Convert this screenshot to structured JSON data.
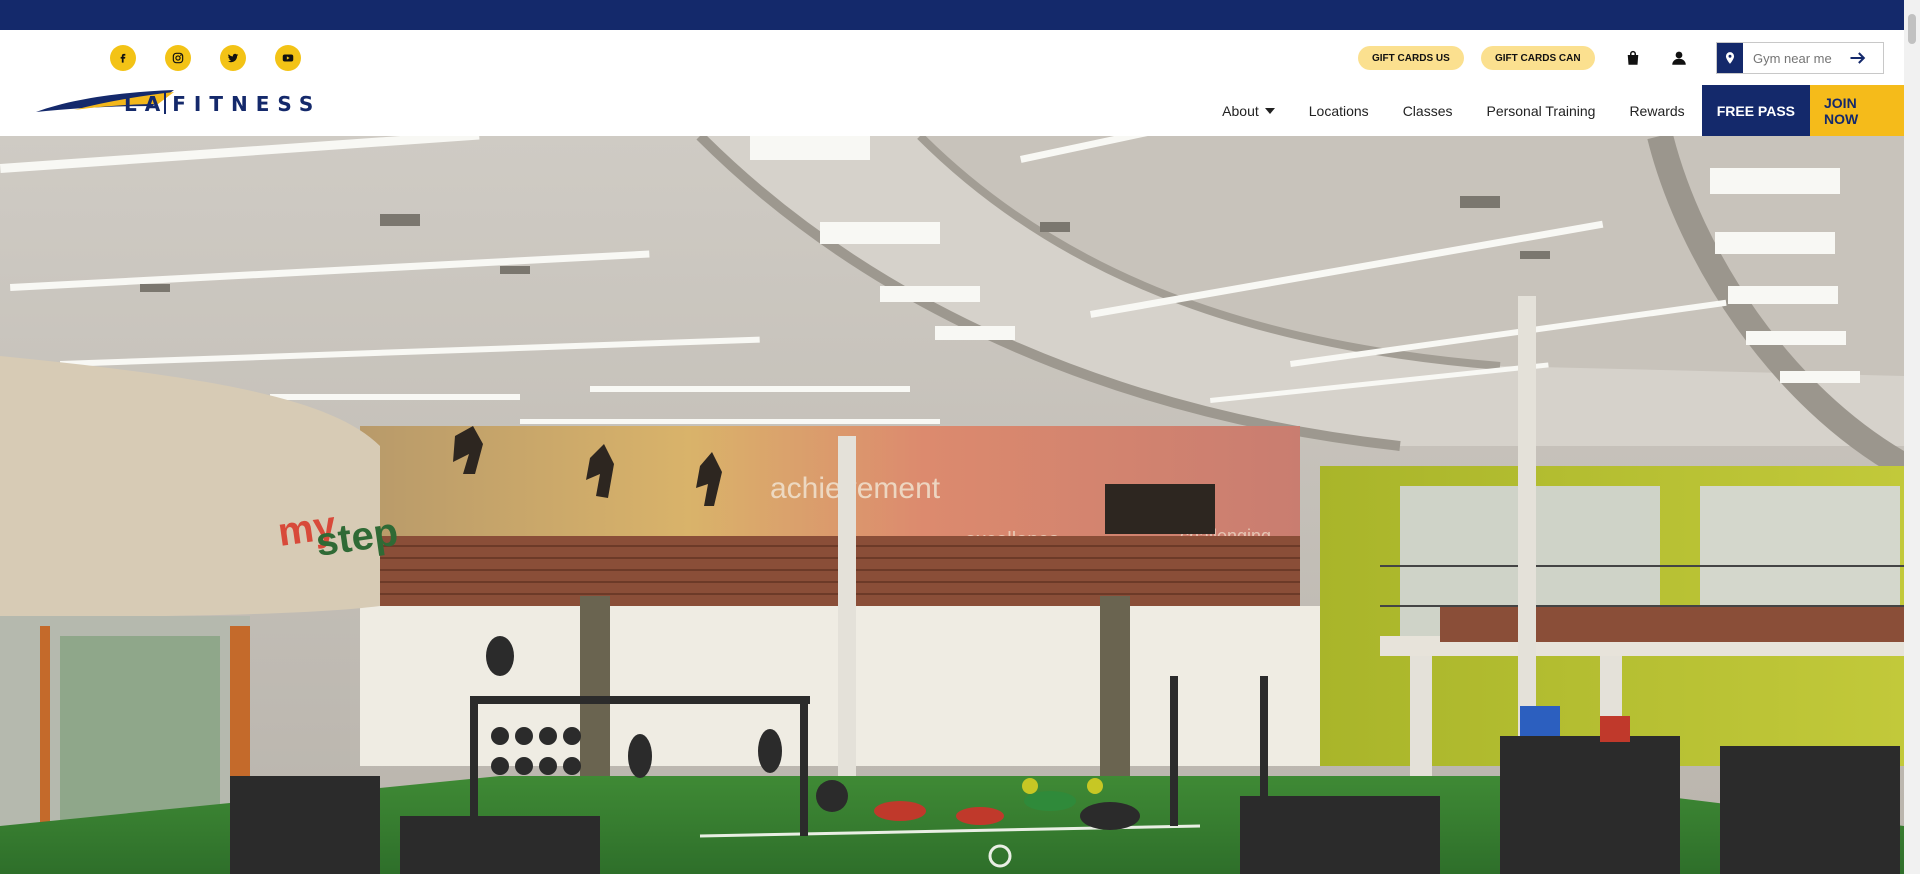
{
  "social": [
    {
      "name": "facebook-icon"
    },
    {
      "name": "instagram-icon"
    },
    {
      "name": "twitter-icon"
    },
    {
      "name": "youtube-icon"
    }
  ],
  "logo": {
    "text_left": "LA",
    "text_right": "FITNESS",
    "alt": "LA FITNESS"
  },
  "utility": {
    "gift_us": "GIFT CARDS US",
    "gift_can": "GIFT CARDS CAN",
    "search_placeholder": "Gym near me"
  },
  "nav": {
    "about": "About",
    "locations": "Locations",
    "classes": "Classes",
    "personal_training": "Personal Training",
    "rewards": "Rewards",
    "free_pass": "FREE PASS",
    "join_now": "JOIN NOW"
  },
  "hero": {
    "mural_words": [
      "achievement",
      "excellence",
      "challenging"
    ],
    "brand_sign": "mystep"
  },
  "colors": {
    "navy": "#14296b",
    "gold": "#f5bb1a",
    "icon_yellow": "#f3c316",
    "giftcard_bg": "#fbe08f"
  }
}
